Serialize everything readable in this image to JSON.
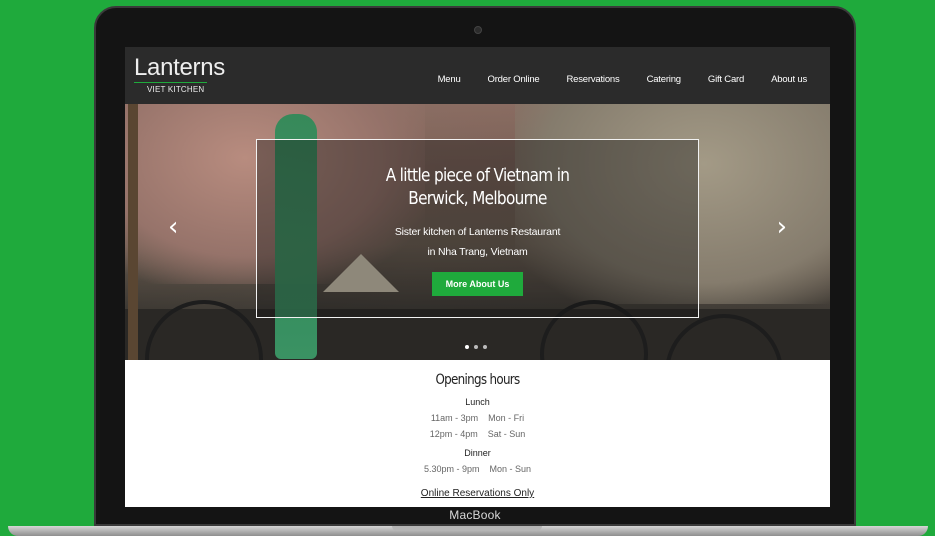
{
  "brand": {
    "name": "Lanterns",
    "subtitle": "VIET KITCHEN"
  },
  "nav": [
    "Menu",
    "Order Online",
    "Reservations",
    "Catering",
    "Gift Card",
    "About us"
  ],
  "hero": {
    "title_line1": "A little piece of Vietnam in",
    "title_line2": "Berwick, Melbourne",
    "subtitle_line1": "Sister kitchen of Lanterns Restaurant",
    "subtitle_line2": "in Nha Trang, Vietnam",
    "button_label": "More About Us",
    "arrow_left": "‹",
    "arrow_right": "›",
    "slides": 3,
    "active_slide": 1
  },
  "hours": {
    "title": "Openings hours",
    "lunch_title": "Lunch",
    "lunch": [
      {
        "time": "11am - 3pm",
        "days": "Mon - Fri"
      },
      {
        "time": "12pm - 4pm",
        "days": "Sat - Sun"
      }
    ],
    "dinner_title": "Dinner",
    "dinner": [
      {
        "time": "5.30pm - 9pm",
        "days": "Mon - Sun"
      }
    ],
    "reservation_link": "Online Reservations Only"
  },
  "device_label": "MacBook",
  "colors": {
    "background": "#1faa3c",
    "accent": "#1faa3c",
    "navbar": "#2b2b2b"
  }
}
